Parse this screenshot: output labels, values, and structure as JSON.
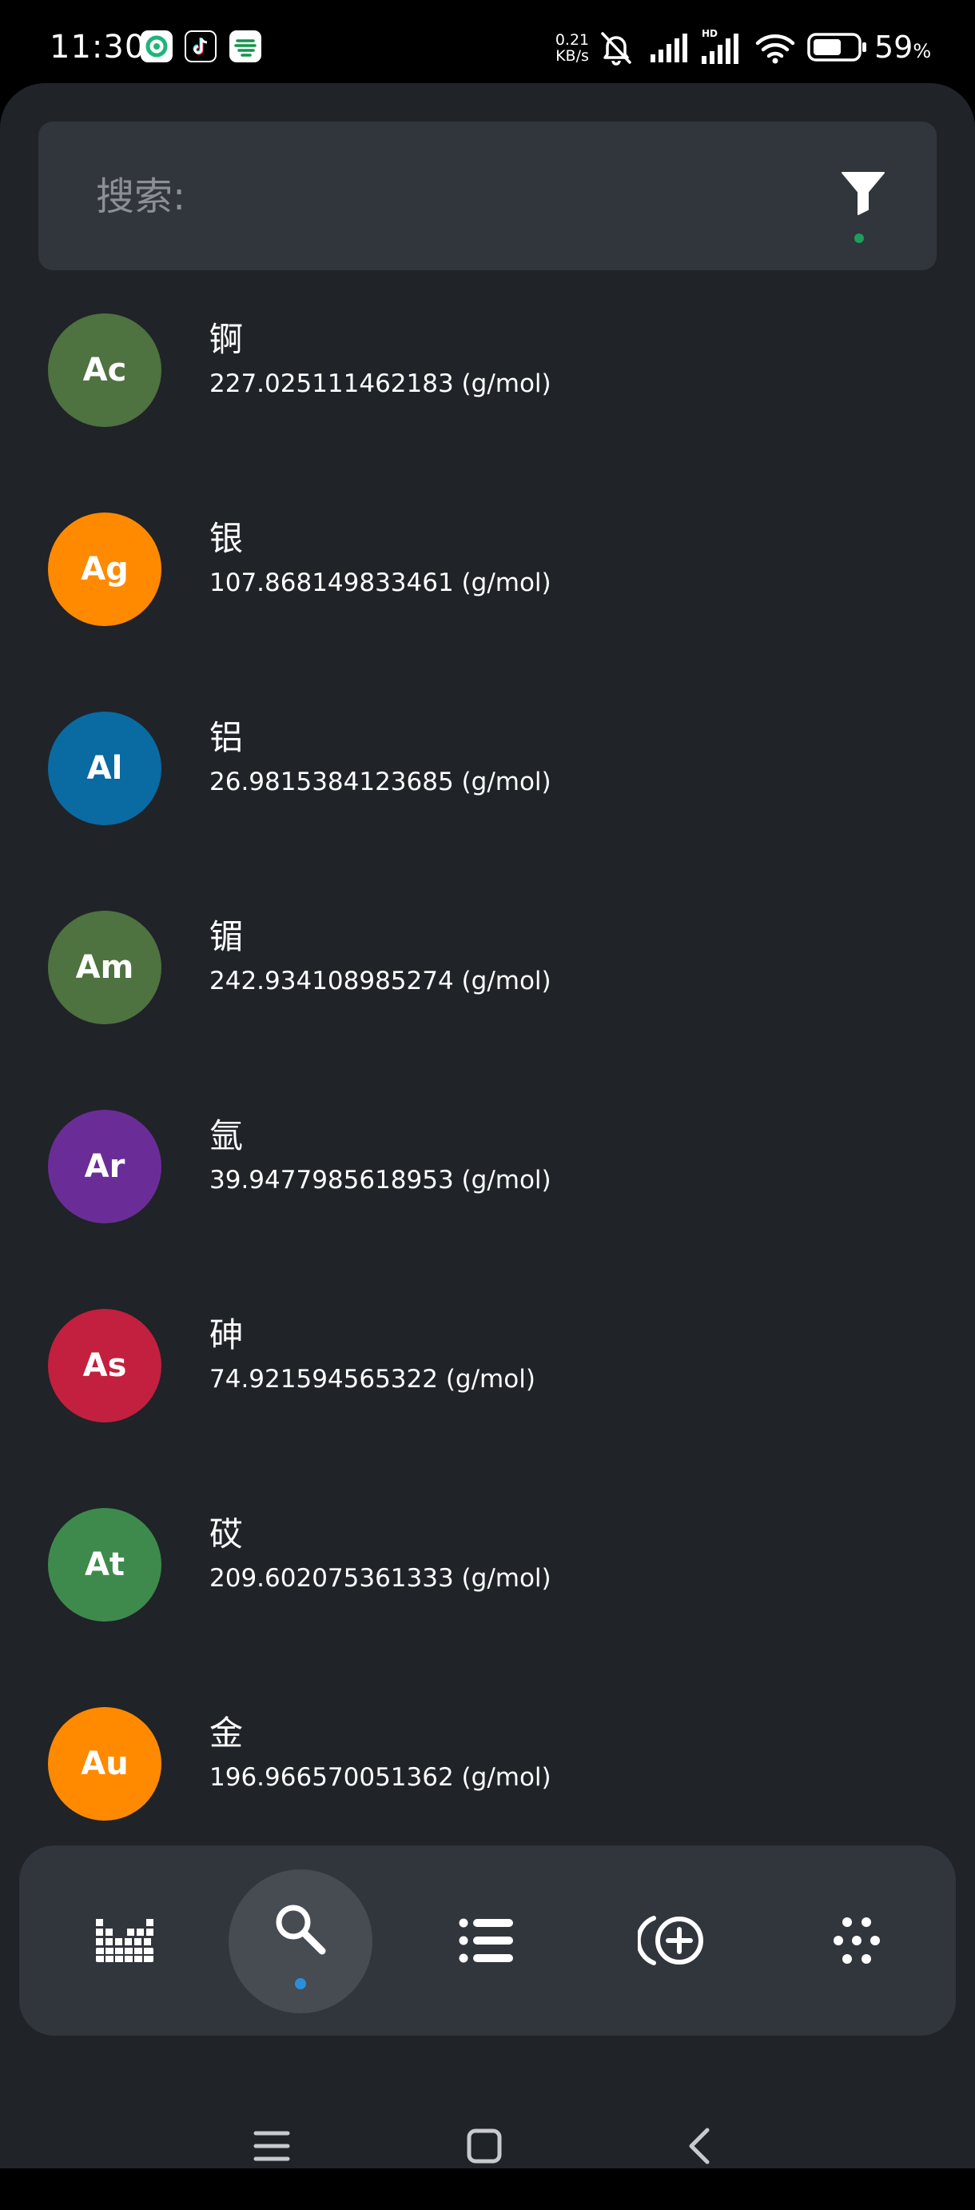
{
  "status_bar": {
    "time": "11:30",
    "net_speed_value": "0.21",
    "net_speed_unit": "KB/s",
    "battery_percent": "59",
    "battery_unit": "%"
  },
  "search": {
    "label": "搜索:",
    "filter_icon": "filter-icon"
  },
  "elements": [
    {
      "symbol": "Ac",
      "name": "锕",
      "mass": "227.025111462183 (g/mol)",
      "color": "#4e7240"
    },
    {
      "symbol": "Ag",
      "name": "银",
      "mass": "107.868149833461 (g/mol)",
      "color": "#ff8a00"
    },
    {
      "symbol": "Al",
      "name": "铝",
      "mass": "26.9815384123685 (g/mol)",
      "color": "#0a6aa2"
    },
    {
      "symbol": "Am",
      "name": "镅",
      "mass": "242.934108985274 (g/mol)",
      "color": "#4e7240"
    },
    {
      "symbol": "Ar",
      "name": "氩",
      "mass": "39.9477985618953 (g/mol)",
      "color": "#6a2d98"
    },
    {
      "symbol": "As",
      "name": "砷",
      "mass": "74.921594565322 (g/mol)",
      "color": "#c31f3e"
    },
    {
      "symbol": "At",
      "name": "砹",
      "mass": "209.602075361333 (g/mol)",
      "color": "#3e8a4c"
    },
    {
      "symbol": "Au",
      "name": "金",
      "mass": "196.966570051362 (g/mol)",
      "color": "#ff8a00"
    }
  ],
  "bottom_nav": {
    "items": [
      "periodic-table-icon",
      "search-icon",
      "list-icon",
      "add-molecule-icon",
      "dots-grid-icon"
    ],
    "selected": "search-icon",
    "accent": "#2a8fd8"
  },
  "system_nav": [
    "menu-icon",
    "home-icon",
    "back-icon"
  ]
}
